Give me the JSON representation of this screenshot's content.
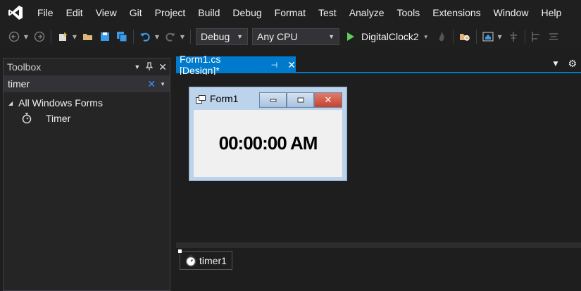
{
  "menu": [
    "File",
    "Edit",
    "View",
    "Git",
    "Project",
    "Build",
    "Debug",
    "Format",
    "Test",
    "Analyze",
    "Tools",
    "Extensions",
    "Window",
    "Help"
  ],
  "toolbar": {
    "configuration": "Debug",
    "platform": "Any CPU",
    "startup_project": "DigitalClock2"
  },
  "toolbox": {
    "title": "Toolbox",
    "search_value": "timer",
    "category": "All Windows Forms",
    "items": [
      "Timer"
    ]
  },
  "tab": {
    "label": "Form1.cs [Design]*"
  },
  "form": {
    "title": "Form1",
    "clock_text": "00:00:00 AM"
  },
  "tray": {
    "component": "timer1"
  },
  "colors": {
    "accent": "#007acc",
    "play": "#5ecf58",
    "vs_logo": "#ffffff"
  }
}
